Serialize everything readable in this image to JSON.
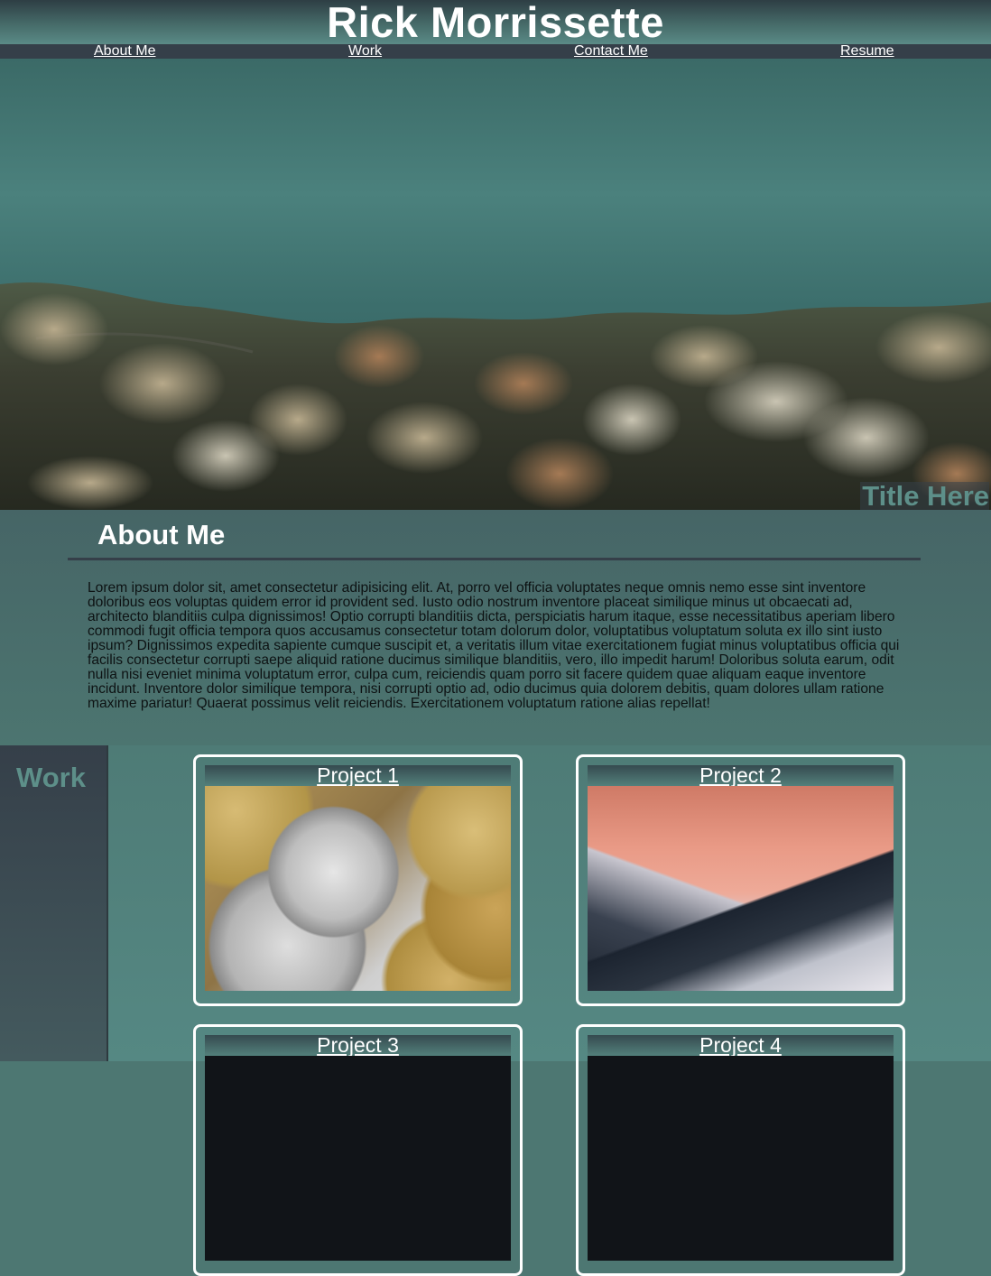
{
  "header": {
    "title": "Rick Morrissette"
  },
  "nav": {
    "items": [
      {
        "label": "About Me"
      },
      {
        "label": "Work"
      },
      {
        "label": "Contact Me"
      },
      {
        "label": "Resume"
      }
    ]
  },
  "hero": {
    "title": "Title Here"
  },
  "about": {
    "heading": "About Me",
    "text": "Lorem ipsum dolor sit, amet consectetur adipisicing elit. At, porro vel officia voluptates neque omnis nemo esse sint inventore doloribus eos voluptas quidem error id provident sed. Iusto odio nostrum inventore placeat similique minus ut obcaecati ad, architecto blanditiis culpa dignissimos! Optio corrupti blanditiis dicta, perspiciatis harum itaque, esse necessitatibus aperiam libero commodi fugit officia tempora quos accusamus consectetur totam dolorum dolor, voluptatibus voluptatum soluta ex illo sint iusto ipsum? Dignissimos expedita sapiente cumque suscipit et, a veritatis illum vitae exercitationem fugiat minus voluptatibus officia qui facilis consectetur corrupti saepe aliquid ratione ducimus similique blanditiis, vero, illo impedit harum! Doloribus soluta earum, odit nulla nisi eveniet minima voluptatum error, culpa cum, reiciendis quam porro sit facere quidem quae aliquam eaque inventore incidunt. Inventore dolor similique tempora, nisi corrupti optio ad, odio ducimus quia dolorem debitis, quam dolores ullam ratione maxime pariatur! Quaerat possimus velit reiciendis. Exercitationem voluptatum ratione alias repellat!"
  },
  "work": {
    "heading": "Work",
    "projects": [
      {
        "label": "Project 1",
        "image": "coins-photo"
      },
      {
        "label": "Project 2",
        "image": "mountains-photo"
      },
      {
        "label": "Project 3",
        "image": "dark-photo"
      },
      {
        "label": "Project 4",
        "image": "dark-photo"
      }
    ]
  },
  "colors": {
    "accent_teal": "#5d8f89",
    "nav_dark": "#353f49",
    "text_white": "#ffffff"
  }
}
